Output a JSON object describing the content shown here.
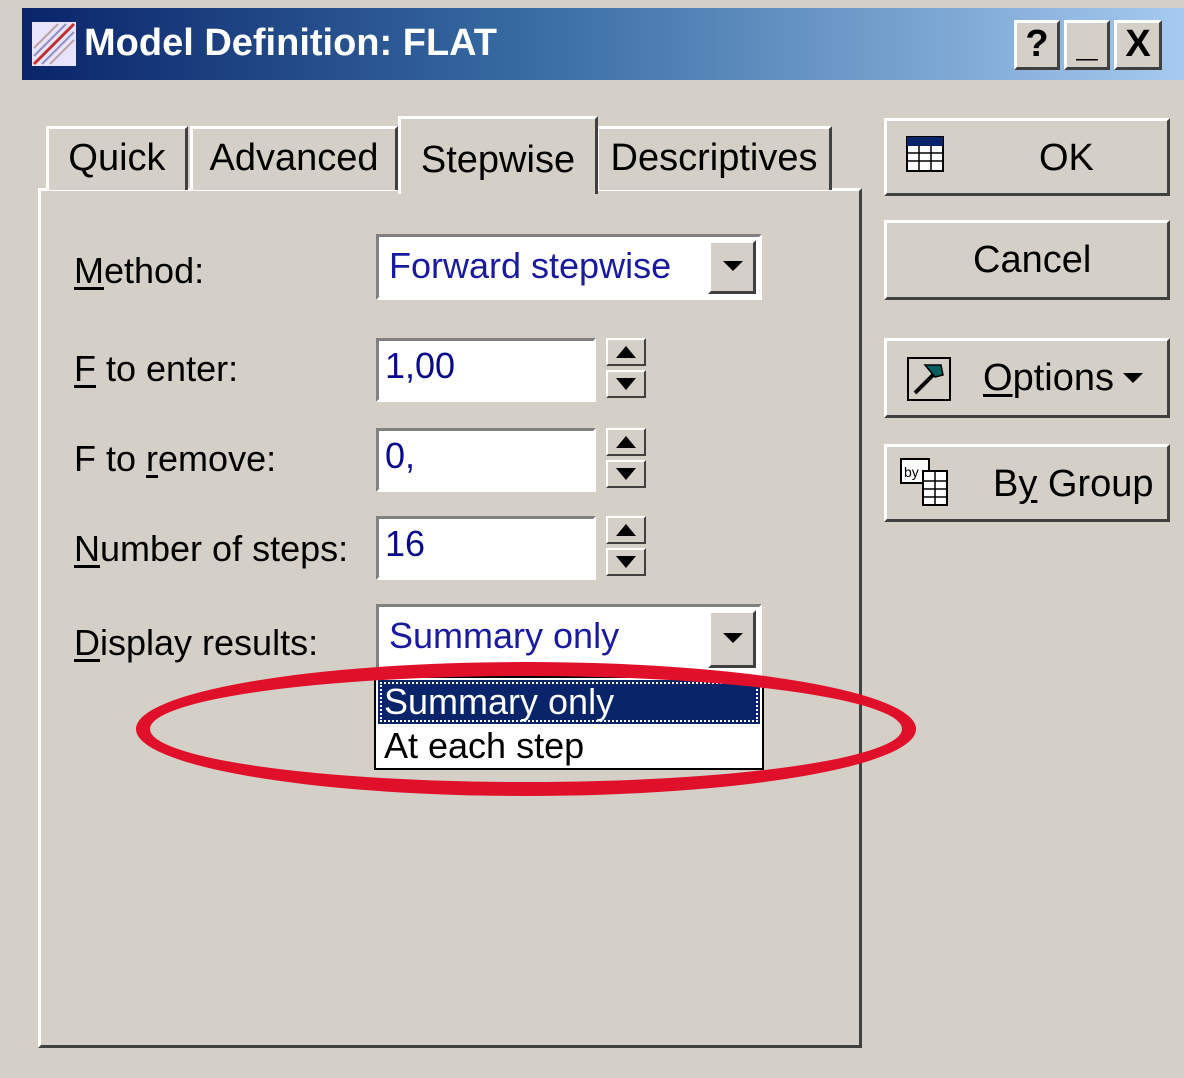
{
  "window": {
    "title": "Model Definition: FLAT",
    "help_label": "?",
    "minimize_label": "_",
    "close_label": "X"
  },
  "tabs": [
    {
      "label": "Quick",
      "active": false
    },
    {
      "label": "Advanced",
      "active": false
    },
    {
      "label": "Stepwise",
      "active": true
    },
    {
      "label": "Descriptives",
      "active": false
    }
  ],
  "form": {
    "method": {
      "label_pre": "",
      "label_mn": "M",
      "label_post": "ethod:",
      "value": "Forward stepwise"
    },
    "f_to_enter": {
      "label_pre": "",
      "label_mn": "F",
      "label_post": " to enter:",
      "value": "1,00"
    },
    "f_to_remove": {
      "label_pre": "F to ",
      "label_mn": "r",
      "label_post": "emove:",
      "value": "0,"
    },
    "number_of_steps": {
      "label_pre": "",
      "label_mn": "N",
      "label_post": "umber of steps:",
      "value": "16"
    },
    "display_results": {
      "label_pre": "",
      "label_mn": "D",
      "label_post": "isplay results:",
      "value": "Summary only",
      "options": [
        "Summary only",
        "At each step"
      ],
      "highlighted_option": 0
    }
  },
  "buttons": {
    "ok": "OK",
    "cancel": "Cancel",
    "options_pre": "",
    "options_mn": "O",
    "options_post": "ptions",
    "by_group_pre": "B",
    "by_group_mn": "y",
    "by_group_post": " Group"
  },
  "colors": {
    "title_gradient_start": "#0a246a",
    "title_gradient_end": "#a6caf0",
    "dialog_face": "#d4d0c8",
    "annotation_ellipse": "#e0102a",
    "combo_text": "#1a1a9e"
  },
  "icons": {
    "app": "model-definition-icon",
    "ok": "table-sheet-icon",
    "options": "hammer-icon",
    "by_group": "by-group-icon"
  }
}
